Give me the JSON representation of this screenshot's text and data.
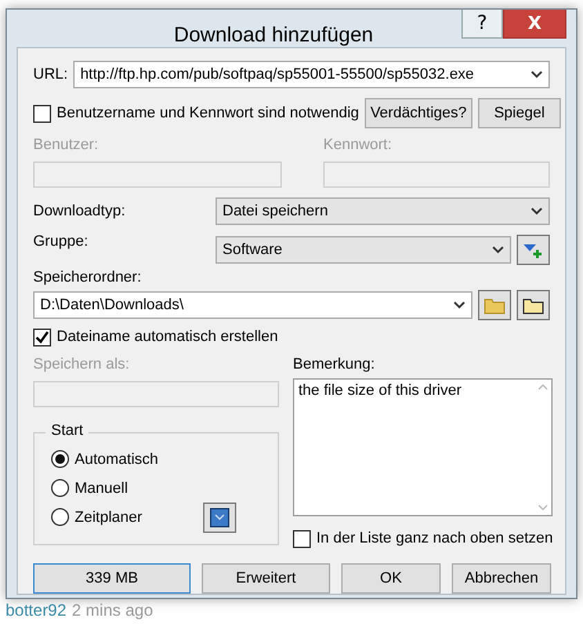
{
  "window": {
    "title": "Download hinzufügen",
    "help": "?",
    "close": "X"
  },
  "url": {
    "label": "URL:",
    "value": "http://ftp.hp.com/pub/softpaq/sp55001-55500/sp55032.exe"
  },
  "auth": {
    "label": "Benutzername und Kennwort sind notwendig",
    "checked": false
  },
  "auth_buttons": [
    "Verdächtiges?",
    "Spiegel"
  ],
  "user": {
    "label": "Benutzer:",
    "disabled": true
  },
  "password": {
    "label": "Kennwort:",
    "disabled": true
  },
  "download_type": {
    "label": "Downloadtyp:",
    "value": "Datei speichern"
  },
  "group": {
    "label": "Gruppe:",
    "value": "Software"
  },
  "folder": {
    "label": "Speicherordner:",
    "value": "D:\\Daten\\Downloads\\"
  },
  "auto_name": {
    "label": "Dateiname automatisch erstellen",
    "checked": true
  },
  "save_as": {
    "label": "Speichern als:",
    "disabled": true
  },
  "comment": {
    "label": "Bemerkung:",
    "value": "the file size of this driver"
  },
  "start": {
    "title": "Start",
    "options": [
      {
        "label": "Automatisch",
        "selected": true
      },
      {
        "label": "Manuell",
        "selected": false
      },
      {
        "label": "Zeitplaner",
        "selected": false
      }
    ]
  },
  "top_of_list": {
    "label": "In der Liste ganz nach oben setzen",
    "checked": false
  },
  "buttons": [
    "339 MB",
    "Erweitert",
    "OK",
    "Abbrechen"
  ],
  "background_text": {
    "user": "botter92",
    "time": "2 mins ago"
  }
}
